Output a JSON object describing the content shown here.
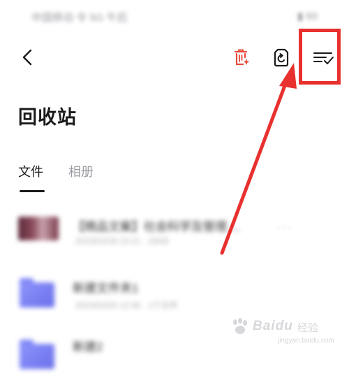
{
  "status_bar": {
    "left_text": "中国移动 令 5G 午后",
    "right_text": "▮ 60"
  },
  "nav": {
    "back_icon": "chevron-left-icon",
    "actions": [
      {
        "name": "clean-button",
        "icon": "trash-sparkle-icon",
        "color": "#e64a3c"
      },
      {
        "name": "restore-button",
        "icon": "restore-icon",
        "color": "#1a1a1a"
      },
      {
        "name": "multi-select-button",
        "icon": "list-check-icon",
        "color": "#1a1a1a"
      }
    ]
  },
  "page": {
    "title": "回收站"
  },
  "tabs": [
    {
      "label": "文件",
      "active": true
    },
    {
      "label": "相册",
      "active": false
    }
  ],
  "files": [
    {
      "title": "【精品文案】社会科学及管理....",
      "meta": "2023/03/28 15:21 · 25KB",
      "kind": "image"
    },
    {
      "title": "新建文件夹1",
      "meta": "2023/03/20 12:46 · 1个文件",
      "kind": "folder"
    },
    {
      "title": "新建2",
      "meta": "",
      "kind": "folder"
    }
  ],
  "annotation": {
    "color": "#e8312f"
  },
  "watermark": {
    "text": "Baidu",
    "sub": "经验",
    "url": "jingyan.baidu.com"
  }
}
